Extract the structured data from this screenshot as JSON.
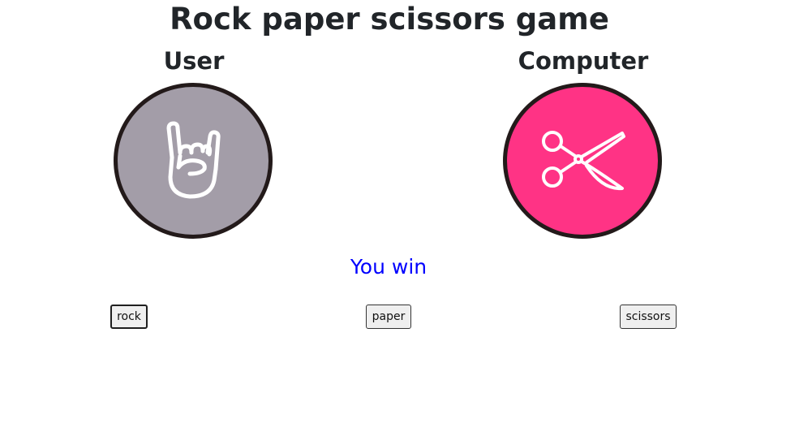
{
  "title": "Rock paper scissors game",
  "players": {
    "user": {
      "label": "User",
      "choice_icon": "rock-hand-icon",
      "circle_color": "#a39da8"
    },
    "computer": {
      "label": "Computer",
      "choice_icon": "scissors-icon",
      "circle_color": "#ff3385"
    }
  },
  "result": {
    "text": "You win",
    "color": "#0000ff"
  },
  "buttons": {
    "rock": "rock",
    "paper": "paper",
    "scissors": "scissors"
  }
}
